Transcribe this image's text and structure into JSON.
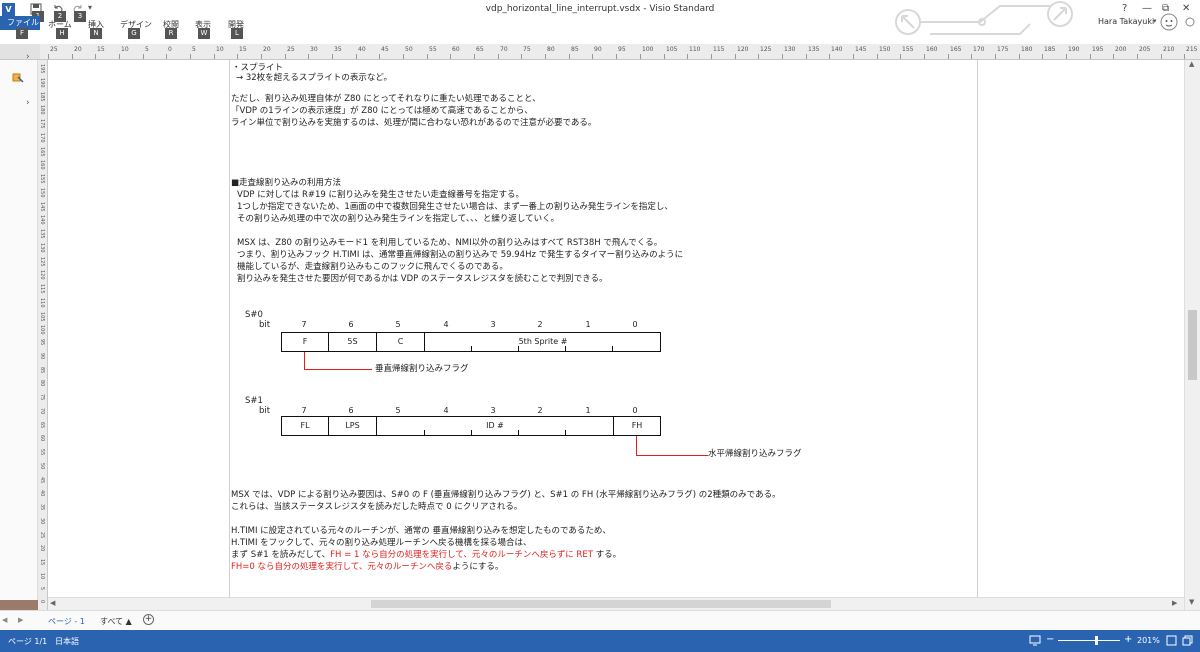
{
  "window": {
    "title": "vdp_horizontal_line_interrupt.vsdx - Visio Standard",
    "controls": {
      "help": "?",
      "minimize": "—",
      "restore": "⧉",
      "close": "✕"
    }
  },
  "qat": {
    "keytips": [
      "1",
      "2",
      "3"
    ]
  },
  "ribbon": {
    "file_tab": "ファイル",
    "file_keytip": "F",
    "tabs": [
      {
        "label": "ホーム",
        "keytip": "H"
      },
      {
        "label": "挿入",
        "keytip": "N"
      },
      {
        "label": "デザイン",
        "keytip": "G"
      },
      {
        "label": "校閲",
        "keytip": "R"
      },
      {
        "label": "表示",
        "keytip": "W"
      },
      {
        "label": "開発",
        "keytip": "L"
      }
    ]
  },
  "user": {
    "name": "Hara Takayuki"
  },
  "ruler": {
    "labels": [
      "25",
      "20",
      "15",
      "10",
      "5",
      "0",
      "5",
      "10",
      "15",
      "20",
      "25",
      "30",
      "35",
      "40",
      "45",
      "50",
      "55",
      "60",
      "65",
      "70",
      "75",
      "80",
      "85",
      "90",
      "95",
      "100",
      "105",
      "110",
      "115",
      "120",
      "125",
      "130",
      "135",
      "140",
      "145",
      "150",
      "155",
      "160",
      "165",
      "170",
      "175",
      "180",
      "185",
      "190",
      "195",
      "200",
      "205",
      "210",
      "215"
    ]
  },
  "vruler": {
    "labels": [
      "195",
      "190",
      "185",
      "180",
      "175",
      "170",
      "165",
      "160",
      "155",
      "150",
      "145",
      "140",
      "135",
      "130",
      "125",
      "120",
      "115",
      "110",
      "105",
      "100",
      "95",
      "90",
      "85",
      "80",
      "75",
      "70",
      "65",
      "60",
      "55",
      "50",
      "45",
      "40",
      "35",
      "30",
      "25",
      "20",
      "15",
      "10",
      "5",
      "0"
    ]
  },
  "content": {
    "line1": "・スプライト",
    "line2": "→ 32枚を超えるスプライトの表示など。",
    "para1": [
      "ただし、割り込み処理自体が Z80 にとってそれなりに重たい処理であることと、",
      "「VDP の1ラインの表示速度」が Z80 にとっては極めて高速であることから、",
      "ライン単位で割り込みを実施するのは、処理が間に合わない恐れがあるので注意が必要である。"
    ],
    "section_heading": "■走査線割り込みの利用方法",
    "para2": [
      "VDP に対しては R#19 に割り込みを発生させたい走査線番号を指定する。",
      "1つしか指定できないため、1画面の中で複数回発生させたい場合は、まず一番上の割り込み発生ラインを指定し、",
      "その割り込み処理の中で次の割り込み発生ラインを指定して、、、と繰り返していく。"
    ],
    "para3": [
      "MSX は、Z80 の割り込みモード1 を利用しているため、NMI以外の割り込みはすべて RST38H で飛んでくる。",
      "つまり、割り込みフック H.TIMI は、通常垂直帰線割込の割り込みで 59.94Hz で発生するタイマー割り込みのように",
      "機能しているが、走査線割り込みもこのフックに飛んでくるのである。",
      "割り込みを発生させた要因が何であるかは VDP のステータスレジスタを読むことで判別できる。"
    ],
    "s0": {
      "name": "S#0",
      "bit_label": "bit",
      "bits": [
        "7",
        "6",
        "5",
        "4",
        "3",
        "2",
        "1",
        "0"
      ],
      "cells": [
        {
          "text": "F",
          "red": true
        },
        {
          "text": "5S",
          "red": false
        },
        {
          "text": "C",
          "red": false
        },
        {
          "text": "5th Sprite #",
          "red": false
        }
      ],
      "flag_label": "垂直帰線割り込みフラグ"
    },
    "s1": {
      "name": "S#1",
      "bit_label": "bit",
      "bits": [
        "7",
        "6",
        "5",
        "4",
        "3",
        "2",
        "1",
        "0"
      ],
      "cells": [
        {
          "text": "FL",
          "red": false
        },
        {
          "text": "LPS",
          "red": false
        },
        {
          "text": "ID #",
          "red": false
        },
        {
          "text": "FH",
          "red": true
        }
      ],
      "flag_label": "水平帰線割り込みフラグ"
    },
    "para4": [
      "MSX では、VDP による割り込み要因は、S#0 の F (垂直帰線割り込みフラグ) と、S#1 の FH (水平帰線割り込みフラグ) の2種類のみである。",
      "これらは、当該ステータスレジスタを読みだした時点で 0 にクリアされる。"
    ],
    "para5": [
      "H.TIMI に設定されている元々のルーチンが、通常の 垂直帰線割り込みを想定したものであるため、",
      "H.TIMI をフックして、元々の割り込み処理ルーチンへ戻る機構を採る場合は、"
    ],
    "para5_line3": {
      "a": "まず S#1 を読みだして、",
      "b": "FH = 1 なら自分の処理を実行して、元々のルーチンへ戻らずに RET",
      "c": " する。"
    },
    "para5_line4": {
      "a": "FH=0 なら自分の処理を実行して、元々のルーチンへ戻る",
      "b": "ようにする。"
    }
  },
  "page_tabs": {
    "page_label": "ページ - 1",
    "all_label": "すべて ▲",
    "add_label": "+"
  },
  "statusbar": {
    "page": "ページ 1/1",
    "language": "日本語",
    "zoom": "201%",
    "zoom_level": 0.62
  },
  "colors": {
    "accent": "#2a63b0",
    "highlight": "#e02020"
  }
}
